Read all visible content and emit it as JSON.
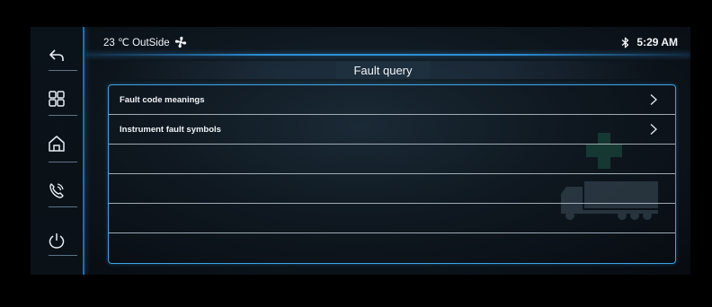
{
  "status": {
    "temperature": "23 ℃ OutSide",
    "fan_icon": "fan-icon",
    "bluetooth_icon": "bluetooth-icon",
    "time": "5:29 AM"
  },
  "page": {
    "title": "Fault query"
  },
  "sidebar": {
    "items": [
      {
        "icon": "back-icon"
      },
      {
        "icon": "apps-grid-icon"
      },
      {
        "icon": "home-icon"
      },
      {
        "icon": "phone-icon"
      },
      {
        "icon": "power-icon"
      }
    ]
  },
  "menu": {
    "items": [
      {
        "label": "Fault code meanings"
      },
      {
        "label": "Instrument fault symbols"
      },
      {
        "label": ""
      },
      {
        "label": ""
      },
      {
        "label": ""
      }
    ]
  },
  "colors": {
    "accent": "#3ea3e6",
    "text": "#f2f5f8",
    "background": "#0f1820"
  }
}
